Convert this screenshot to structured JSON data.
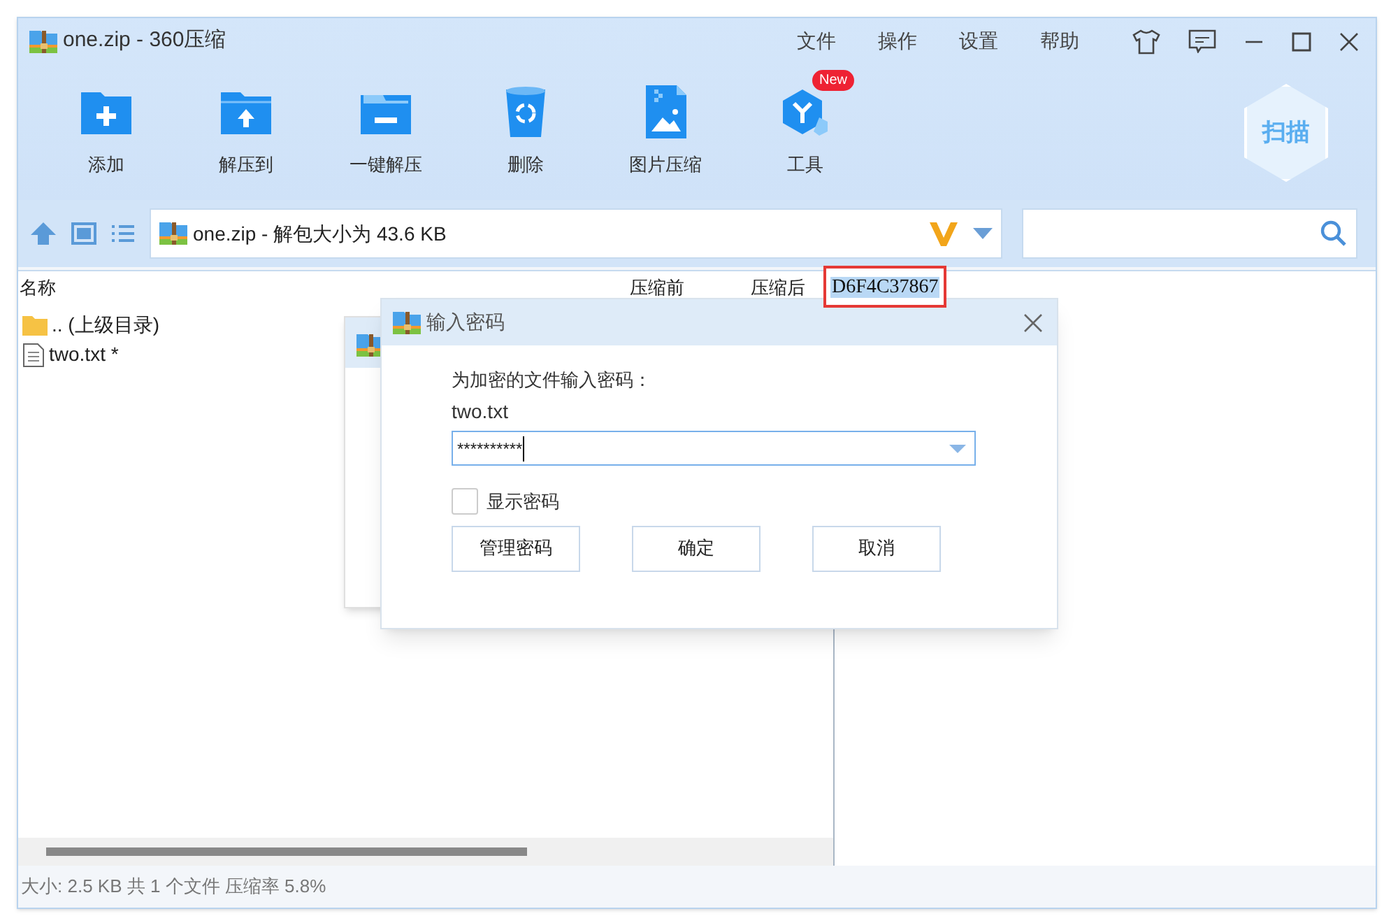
{
  "window": {
    "title": "one.zip - 360压缩"
  },
  "menu": [
    "文件",
    "操作",
    "设置",
    "帮助"
  ],
  "toolbar": [
    {
      "label": "添加",
      "kind": "add"
    },
    {
      "label": "解压到",
      "kind": "extract"
    },
    {
      "label": "一键解压",
      "kind": "quick"
    },
    {
      "label": "删除",
      "kind": "delete"
    },
    {
      "label": "图片压缩",
      "kind": "image"
    },
    {
      "label": "工具",
      "kind": "tools",
      "badge": "New"
    }
  ],
  "scan_button": {
    "label": "扫描"
  },
  "address_bar": {
    "path": "one.zip - 解包大小为 43.6 KB"
  },
  "columns": [
    "名称",
    "压缩前",
    "压缩后"
  ],
  "highlighted_text": "D6F4C37867",
  "files": [
    {
      "name": ".. (上级目录)",
      "kind": "folder"
    },
    {
      "name": "two.txt *",
      "kind": "file"
    }
  ],
  "dialog": {
    "title": "输入密码",
    "prompt": "为加密的文件输入密码：",
    "file": "two.txt",
    "password": "**********",
    "show_password": false,
    "show_password_label": "显示密码",
    "buttons": [
      "管理密码",
      "确定",
      "取消"
    ]
  },
  "status_bar": "大小: 2.5 KB 共 1 个文件 压缩率 5.8%"
}
